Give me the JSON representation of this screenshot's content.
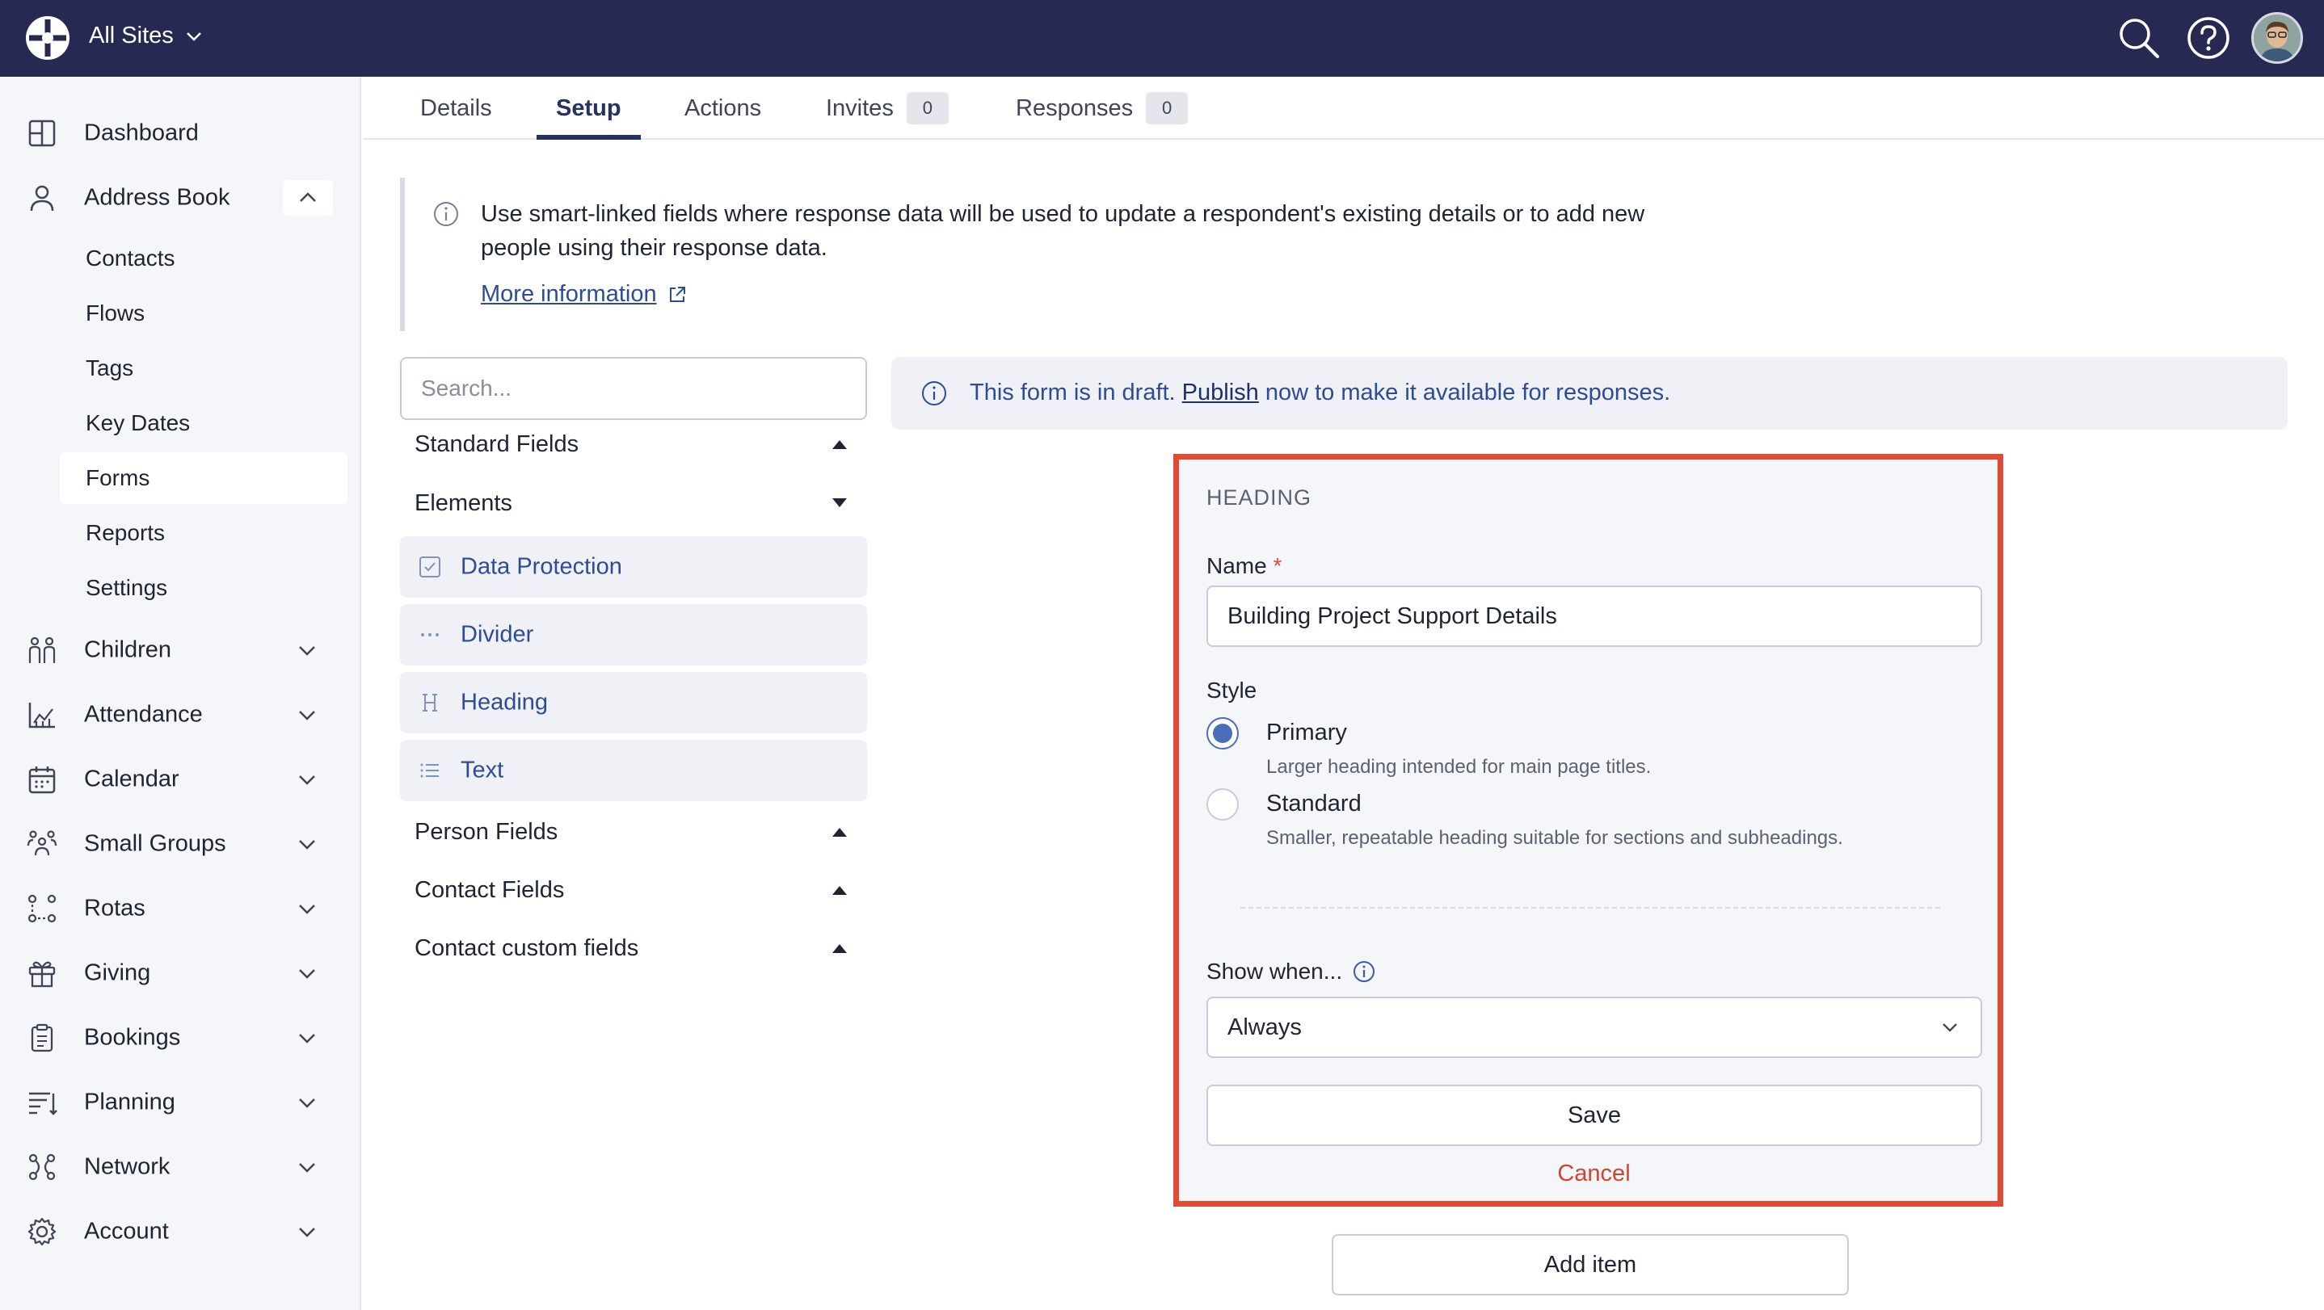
{
  "topbar": {
    "site_switch": "All Sites",
    "icons": [
      "logo-icon",
      "search-icon",
      "help-icon",
      "avatar"
    ]
  },
  "sidebar": {
    "items": [
      {
        "label": "Dashboard",
        "icon": "dashboard-icon"
      },
      {
        "label": "Address Book",
        "icon": "person-icon",
        "expanded": true
      },
      {
        "label": "Children",
        "icon": "children-icon"
      },
      {
        "label": "Attendance",
        "icon": "attendance-icon"
      },
      {
        "label": "Calendar",
        "icon": "calendar-icon"
      },
      {
        "label": "Small Groups",
        "icon": "small-groups-icon"
      },
      {
        "label": "Rotas",
        "icon": "rotas-icon"
      },
      {
        "label": "Giving",
        "icon": "gift-icon"
      },
      {
        "label": "Bookings",
        "icon": "clipboard-icon"
      },
      {
        "label": "Planning",
        "icon": "planning-icon"
      },
      {
        "label": "Network",
        "icon": "network-icon"
      },
      {
        "label": "Account",
        "icon": "gear-icon"
      }
    ],
    "address_book_sub": [
      "Contacts",
      "Flows",
      "Tags",
      "Key Dates",
      "Forms",
      "Reports",
      "Settings"
    ],
    "active_sub": "Forms"
  },
  "tabs": [
    {
      "label": "Details"
    },
    {
      "label": "Setup",
      "active": true
    },
    {
      "label": "Actions"
    },
    {
      "label": "Invites",
      "count": "0"
    },
    {
      "label": "Responses",
      "count": "0"
    }
  ],
  "smart_note": {
    "message": "Use smart-linked fields where response data will be used to update a respondent's existing details or to add new people using their response data.",
    "link": "More information"
  },
  "library": {
    "search_placeholder": "Search...",
    "groups": {
      "standard": "Standard Fields",
      "elements": "Elements",
      "person": "Person Fields",
      "contact": "Contact Fields",
      "contact_custom": "Contact custom fields"
    },
    "elements": [
      {
        "label": "Data Protection",
        "icon": "checkbox-icon"
      },
      {
        "label": "Divider",
        "icon": "dots-icon"
      },
      {
        "label": "Heading",
        "icon": "heading-icon"
      },
      {
        "label": "Text",
        "icon": "list-icon"
      }
    ]
  },
  "draft_banner": {
    "before": "This form is in draft. ",
    "link": "Publish",
    "after": " now to make it available for responses."
  },
  "editor": {
    "heading": "HEADING",
    "name_label": "Name",
    "required_mark": "*",
    "name_value": "Building Project Support Details",
    "style_label": "Style",
    "options": [
      {
        "title": "Primary",
        "desc": "Larger heading intended for main page titles.",
        "selected": true
      },
      {
        "title": "Standard",
        "desc": "Smaller, repeatable heading suitable for sections and subheadings.",
        "selected": false
      }
    ],
    "show_when_label": "Show when...",
    "show_when_value": "Always",
    "save": "Save",
    "cancel": "Cancel"
  },
  "add_item": "Add item",
  "colors": {
    "topbar": "#262a52",
    "accent": "#2d4c96",
    "highlight_border": "#e14a33",
    "cancel": "#d4432e"
  }
}
